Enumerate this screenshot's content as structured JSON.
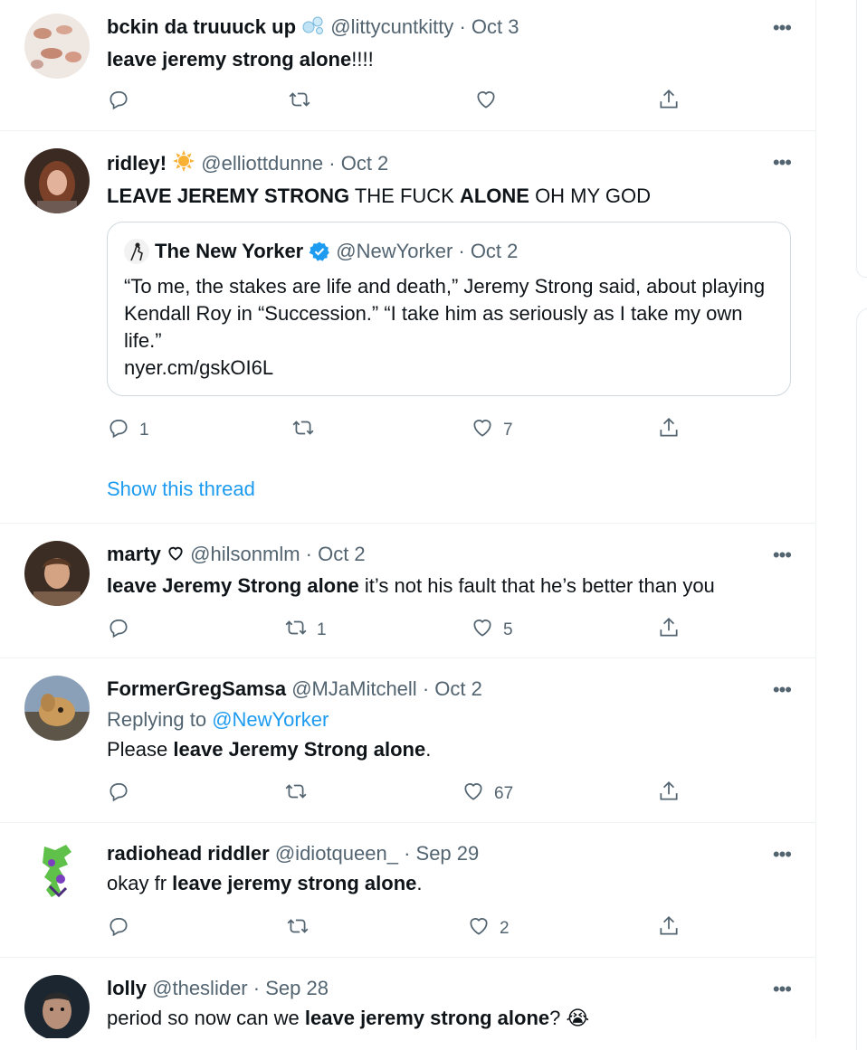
{
  "tweets": [
    {
      "name": "bckin da truuuck up",
      "handle": "@littycuntkitty",
      "date": "· Oct 3",
      "text_bold": "leave jeremy strong alone",
      "text_tail": "!!!!",
      "stats": {
        "reply": "",
        "retweet": "",
        "like": ""
      }
    },
    {
      "name": "ridley!",
      "handle": "@elliottdunne",
      "date": "· Oct 2",
      "text_p1": "LEAVE JEREMY STRONG",
      "text_p2": " THE FUCK ",
      "text_p3": "ALONE",
      "text_p4": " OH MY GOD",
      "stats": {
        "reply": "1",
        "retweet": "",
        "like": "7"
      },
      "show_thread": "Show this thread"
    },
    {
      "name": "marty",
      "handle": "@hilsonmlm",
      "date": "· Oct 2",
      "text_bold": "leave Jeremy Strong alone",
      "text_tail": " it’s not his fault that he’s better than you",
      "stats": {
        "reply": "",
        "retweet": "1",
        "like": "5"
      }
    },
    {
      "name": "FormerGregSamsa",
      "handle": "@MJaMitchell",
      "date": "· Oct 2",
      "replying_label": "Replying to ",
      "replying_to": "@NewYorker",
      "text_head": "Please ",
      "text_bold": "leave Jeremy Strong alone",
      "text_tail": ".",
      "stats": {
        "reply": "",
        "retweet": "",
        "like": "67"
      }
    },
    {
      "name": "radiohead riddler",
      "handle": "@idiotqueen_",
      "date": "· Sep 29",
      "text_head": "okay fr ",
      "text_bold": "leave jeremy strong alone",
      "text_tail": ".",
      "stats": {
        "reply": "",
        "retweet": "",
        "like": "2"
      }
    },
    {
      "name": "lolly",
      "handle": "@theslider",
      "date": "· Sep 28",
      "text_head": "period so now can we ",
      "text_bold": "leave jeremy strong alone",
      "text_tail": "?",
      "emoji": "😭"
    }
  ],
  "quote": {
    "name": "The New Yorker",
    "handle": "@NewYorker",
    "date": "· Oct 2",
    "text": "“To me, the stakes are life and death,” Jeremy Strong said, about playing Kendall Roy in “Succession.” “I take him as seriously as I take my own life.”",
    "link": "nyer.cm/gskOI6L"
  },
  "more_label": "•••",
  "icons": {
    "reply": "reply-icon",
    "retweet": "retweet-icon",
    "like": "like-icon",
    "share": "share-icon",
    "verified": "verified-badge-icon"
  },
  "colors": {
    "link": "#1d9bf0",
    "muted": "#536471",
    "text": "#0f1419",
    "divider": "#eff3f4"
  }
}
